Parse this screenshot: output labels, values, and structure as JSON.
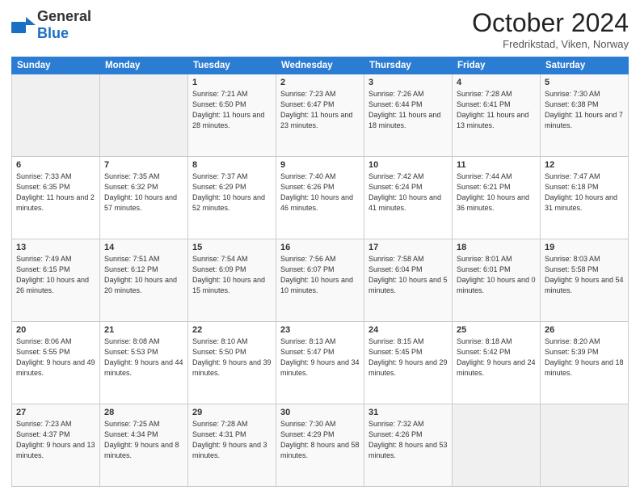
{
  "header": {
    "logo_general": "General",
    "logo_blue": "Blue",
    "month_title": "October 2024",
    "location": "Fredrikstad, Viken, Norway"
  },
  "days_of_week": [
    "Sunday",
    "Monday",
    "Tuesday",
    "Wednesday",
    "Thursday",
    "Friday",
    "Saturday"
  ],
  "weeks": [
    [
      {
        "day": "",
        "sunrise": "",
        "sunset": "",
        "daylight": ""
      },
      {
        "day": "",
        "sunrise": "",
        "sunset": "",
        "daylight": ""
      },
      {
        "day": "1",
        "sunrise": "Sunrise: 7:21 AM",
        "sunset": "Sunset: 6:50 PM",
        "daylight": "Daylight: 11 hours and 28 minutes."
      },
      {
        "day": "2",
        "sunrise": "Sunrise: 7:23 AM",
        "sunset": "Sunset: 6:47 PM",
        "daylight": "Daylight: 11 hours and 23 minutes."
      },
      {
        "day": "3",
        "sunrise": "Sunrise: 7:26 AM",
        "sunset": "Sunset: 6:44 PM",
        "daylight": "Daylight: 11 hours and 18 minutes."
      },
      {
        "day": "4",
        "sunrise": "Sunrise: 7:28 AM",
        "sunset": "Sunset: 6:41 PM",
        "daylight": "Daylight: 11 hours and 13 minutes."
      },
      {
        "day": "5",
        "sunrise": "Sunrise: 7:30 AM",
        "sunset": "Sunset: 6:38 PM",
        "daylight": "Daylight: 11 hours and 7 minutes."
      }
    ],
    [
      {
        "day": "6",
        "sunrise": "Sunrise: 7:33 AM",
        "sunset": "Sunset: 6:35 PM",
        "daylight": "Daylight: 11 hours and 2 minutes."
      },
      {
        "day": "7",
        "sunrise": "Sunrise: 7:35 AM",
        "sunset": "Sunset: 6:32 PM",
        "daylight": "Daylight: 10 hours and 57 minutes."
      },
      {
        "day": "8",
        "sunrise": "Sunrise: 7:37 AM",
        "sunset": "Sunset: 6:29 PM",
        "daylight": "Daylight: 10 hours and 52 minutes."
      },
      {
        "day": "9",
        "sunrise": "Sunrise: 7:40 AM",
        "sunset": "Sunset: 6:26 PM",
        "daylight": "Daylight: 10 hours and 46 minutes."
      },
      {
        "day": "10",
        "sunrise": "Sunrise: 7:42 AM",
        "sunset": "Sunset: 6:24 PM",
        "daylight": "Daylight: 10 hours and 41 minutes."
      },
      {
        "day": "11",
        "sunrise": "Sunrise: 7:44 AM",
        "sunset": "Sunset: 6:21 PM",
        "daylight": "Daylight: 10 hours and 36 minutes."
      },
      {
        "day": "12",
        "sunrise": "Sunrise: 7:47 AM",
        "sunset": "Sunset: 6:18 PM",
        "daylight": "Daylight: 10 hours and 31 minutes."
      }
    ],
    [
      {
        "day": "13",
        "sunrise": "Sunrise: 7:49 AM",
        "sunset": "Sunset: 6:15 PM",
        "daylight": "Daylight: 10 hours and 26 minutes."
      },
      {
        "day": "14",
        "sunrise": "Sunrise: 7:51 AM",
        "sunset": "Sunset: 6:12 PM",
        "daylight": "Daylight: 10 hours and 20 minutes."
      },
      {
        "day": "15",
        "sunrise": "Sunrise: 7:54 AM",
        "sunset": "Sunset: 6:09 PM",
        "daylight": "Daylight: 10 hours and 15 minutes."
      },
      {
        "day": "16",
        "sunrise": "Sunrise: 7:56 AM",
        "sunset": "Sunset: 6:07 PM",
        "daylight": "Daylight: 10 hours and 10 minutes."
      },
      {
        "day": "17",
        "sunrise": "Sunrise: 7:58 AM",
        "sunset": "Sunset: 6:04 PM",
        "daylight": "Daylight: 10 hours and 5 minutes."
      },
      {
        "day": "18",
        "sunrise": "Sunrise: 8:01 AM",
        "sunset": "Sunset: 6:01 PM",
        "daylight": "Daylight: 10 hours and 0 minutes."
      },
      {
        "day": "19",
        "sunrise": "Sunrise: 8:03 AM",
        "sunset": "Sunset: 5:58 PM",
        "daylight": "Daylight: 9 hours and 54 minutes."
      }
    ],
    [
      {
        "day": "20",
        "sunrise": "Sunrise: 8:06 AM",
        "sunset": "Sunset: 5:55 PM",
        "daylight": "Daylight: 9 hours and 49 minutes."
      },
      {
        "day": "21",
        "sunrise": "Sunrise: 8:08 AM",
        "sunset": "Sunset: 5:53 PM",
        "daylight": "Daylight: 9 hours and 44 minutes."
      },
      {
        "day": "22",
        "sunrise": "Sunrise: 8:10 AM",
        "sunset": "Sunset: 5:50 PM",
        "daylight": "Daylight: 9 hours and 39 minutes."
      },
      {
        "day": "23",
        "sunrise": "Sunrise: 8:13 AM",
        "sunset": "Sunset: 5:47 PM",
        "daylight": "Daylight: 9 hours and 34 minutes."
      },
      {
        "day": "24",
        "sunrise": "Sunrise: 8:15 AM",
        "sunset": "Sunset: 5:45 PM",
        "daylight": "Daylight: 9 hours and 29 minutes."
      },
      {
        "day": "25",
        "sunrise": "Sunrise: 8:18 AM",
        "sunset": "Sunset: 5:42 PM",
        "daylight": "Daylight: 9 hours and 24 minutes."
      },
      {
        "day": "26",
        "sunrise": "Sunrise: 8:20 AM",
        "sunset": "Sunset: 5:39 PM",
        "daylight": "Daylight: 9 hours and 18 minutes."
      }
    ],
    [
      {
        "day": "27",
        "sunrise": "Sunrise: 7:23 AM",
        "sunset": "Sunset: 4:37 PM",
        "daylight": "Daylight: 9 hours and 13 minutes."
      },
      {
        "day": "28",
        "sunrise": "Sunrise: 7:25 AM",
        "sunset": "Sunset: 4:34 PM",
        "daylight": "Daylight: 9 hours and 8 minutes."
      },
      {
        "day": "29",
        "sunrise": "Sunrise: 7:28 AM",
        "sunset": "Sunset: 4:31 PM",
        "daylight": "Daylight: 9 hours and 3 minutes."
      },
      {
        "day": "30",
        "sunrise": "Sunrise: 7:30 AM",
        "sunset": "Sunset: 4:29 PM",
        "daylight": "Daylight: 8 hours and 58 minutes."
      },
      {
        "day": "31",
        "sunrise": "Sunrise: 7:32 AM",
        "sunset": "Sunset: 4:26 PM",
        "daylight": "Daylight: 8 hours and 53 minutes."
      },
      {
        "day": "",
        "sunrise": "",
        "sunset": "",
        "daylight": ""
      },
      {
        "day": "",
        "sunrise": "",
        "sunset": "",
        "daylight": ""
      }
    ]
  ]
}
